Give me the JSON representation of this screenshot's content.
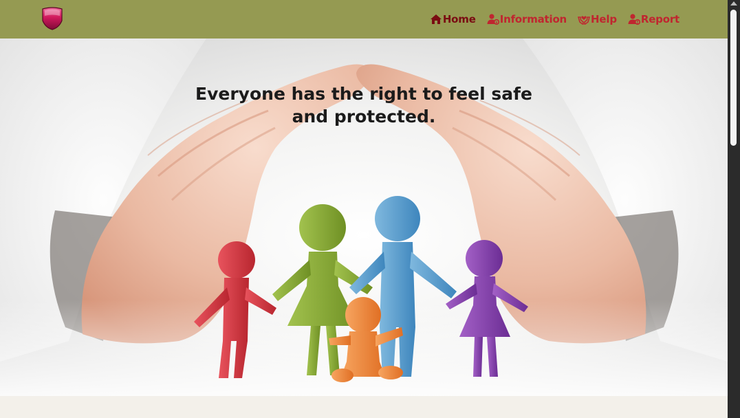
{
  "nav": {
    "items": [
      {
        "label": "Home",
        "icon": "home-icon",
        "active": true
      },
      {
        "label": "Information",
        "icon": "user-info-icon",
        "active": false
      },
      {
        "label": "Help",
        "icon": "helping-hands-icon",
        "active": false
      },
      {
        "label": "Report",
        "icon": "user-report-icon",
        "active": false
      }
    ],
    "background": "#959a52",
    "link_color": "#c0262f",
    "active_color": "#7a0c12"
  },
  "logo": {
    "icon": "shield-icon",
    "color": "#c2185b"
  },
  "hero": {
    "headline": "Everyone has the right to feel safe and protected.",
    "image": "hands-protecting-family-figures"
  }
}
